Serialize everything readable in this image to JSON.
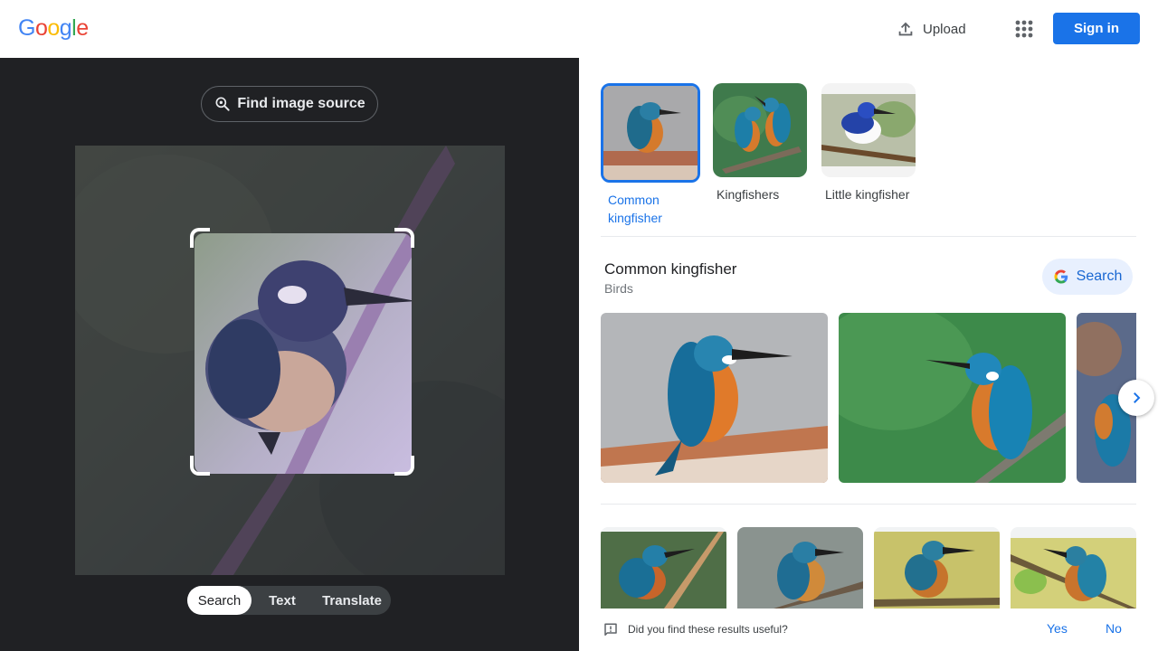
{
  "header": {
    "logo_letters": [
      {
        "ch": "G",
        "color": "#4285f4"
      },
      {
        "ch": "o",
        "color": "#ea4335"
      },
      {
        "ch": "o",
        "color": "#fbbc05"
      },
      {
        "ch": "g",
        "color": "#4285f4"
      },
      {
        "ch": "l",
        "color": "#34a853"
      },
      {
        "ch": "e",
        "color": "#ea4335"
      }
    ],
    "upload_label": "Upload",
    "upload_icon": "upload-icon",
    "apps_icon": "apps-grid-icon",
    "signin_label": "Sign in"
  },
  "left": {
    "find_source_label": "Find image source",
    "find_source_icon": "lens-search-icon",
    "modes": [
      {
        "label": "Search",
        "active": true
      },
      {
        "label": "Text",
        "active": false
      },
      {
        "label": "Translate",
        "active": false
      }
    ]
  },
  "right": {
    "topics": [
      {
        "label": "Common kingfisher",
        "selected": true
      },
      {
        "label": "Kingfishers",
        "selected": false
      },
      {
        "label": "Little kingfisher",
        "selected": false
      }
    ],
    "entity": {
      "title": "Common kingfisher",
      "subtitle": "Birds",
      "search_label": "Search"
    },
    "feedback": {
      "question": "Did you find these results useful?",
      "yes": "Yes",
      "no": "No"
    }
  },
  "colors": {
    "accent": "#1a73e8",
    "dark_panel": "#202124",
    "search_chip_bg": "#e8f0fe"
  }
}
